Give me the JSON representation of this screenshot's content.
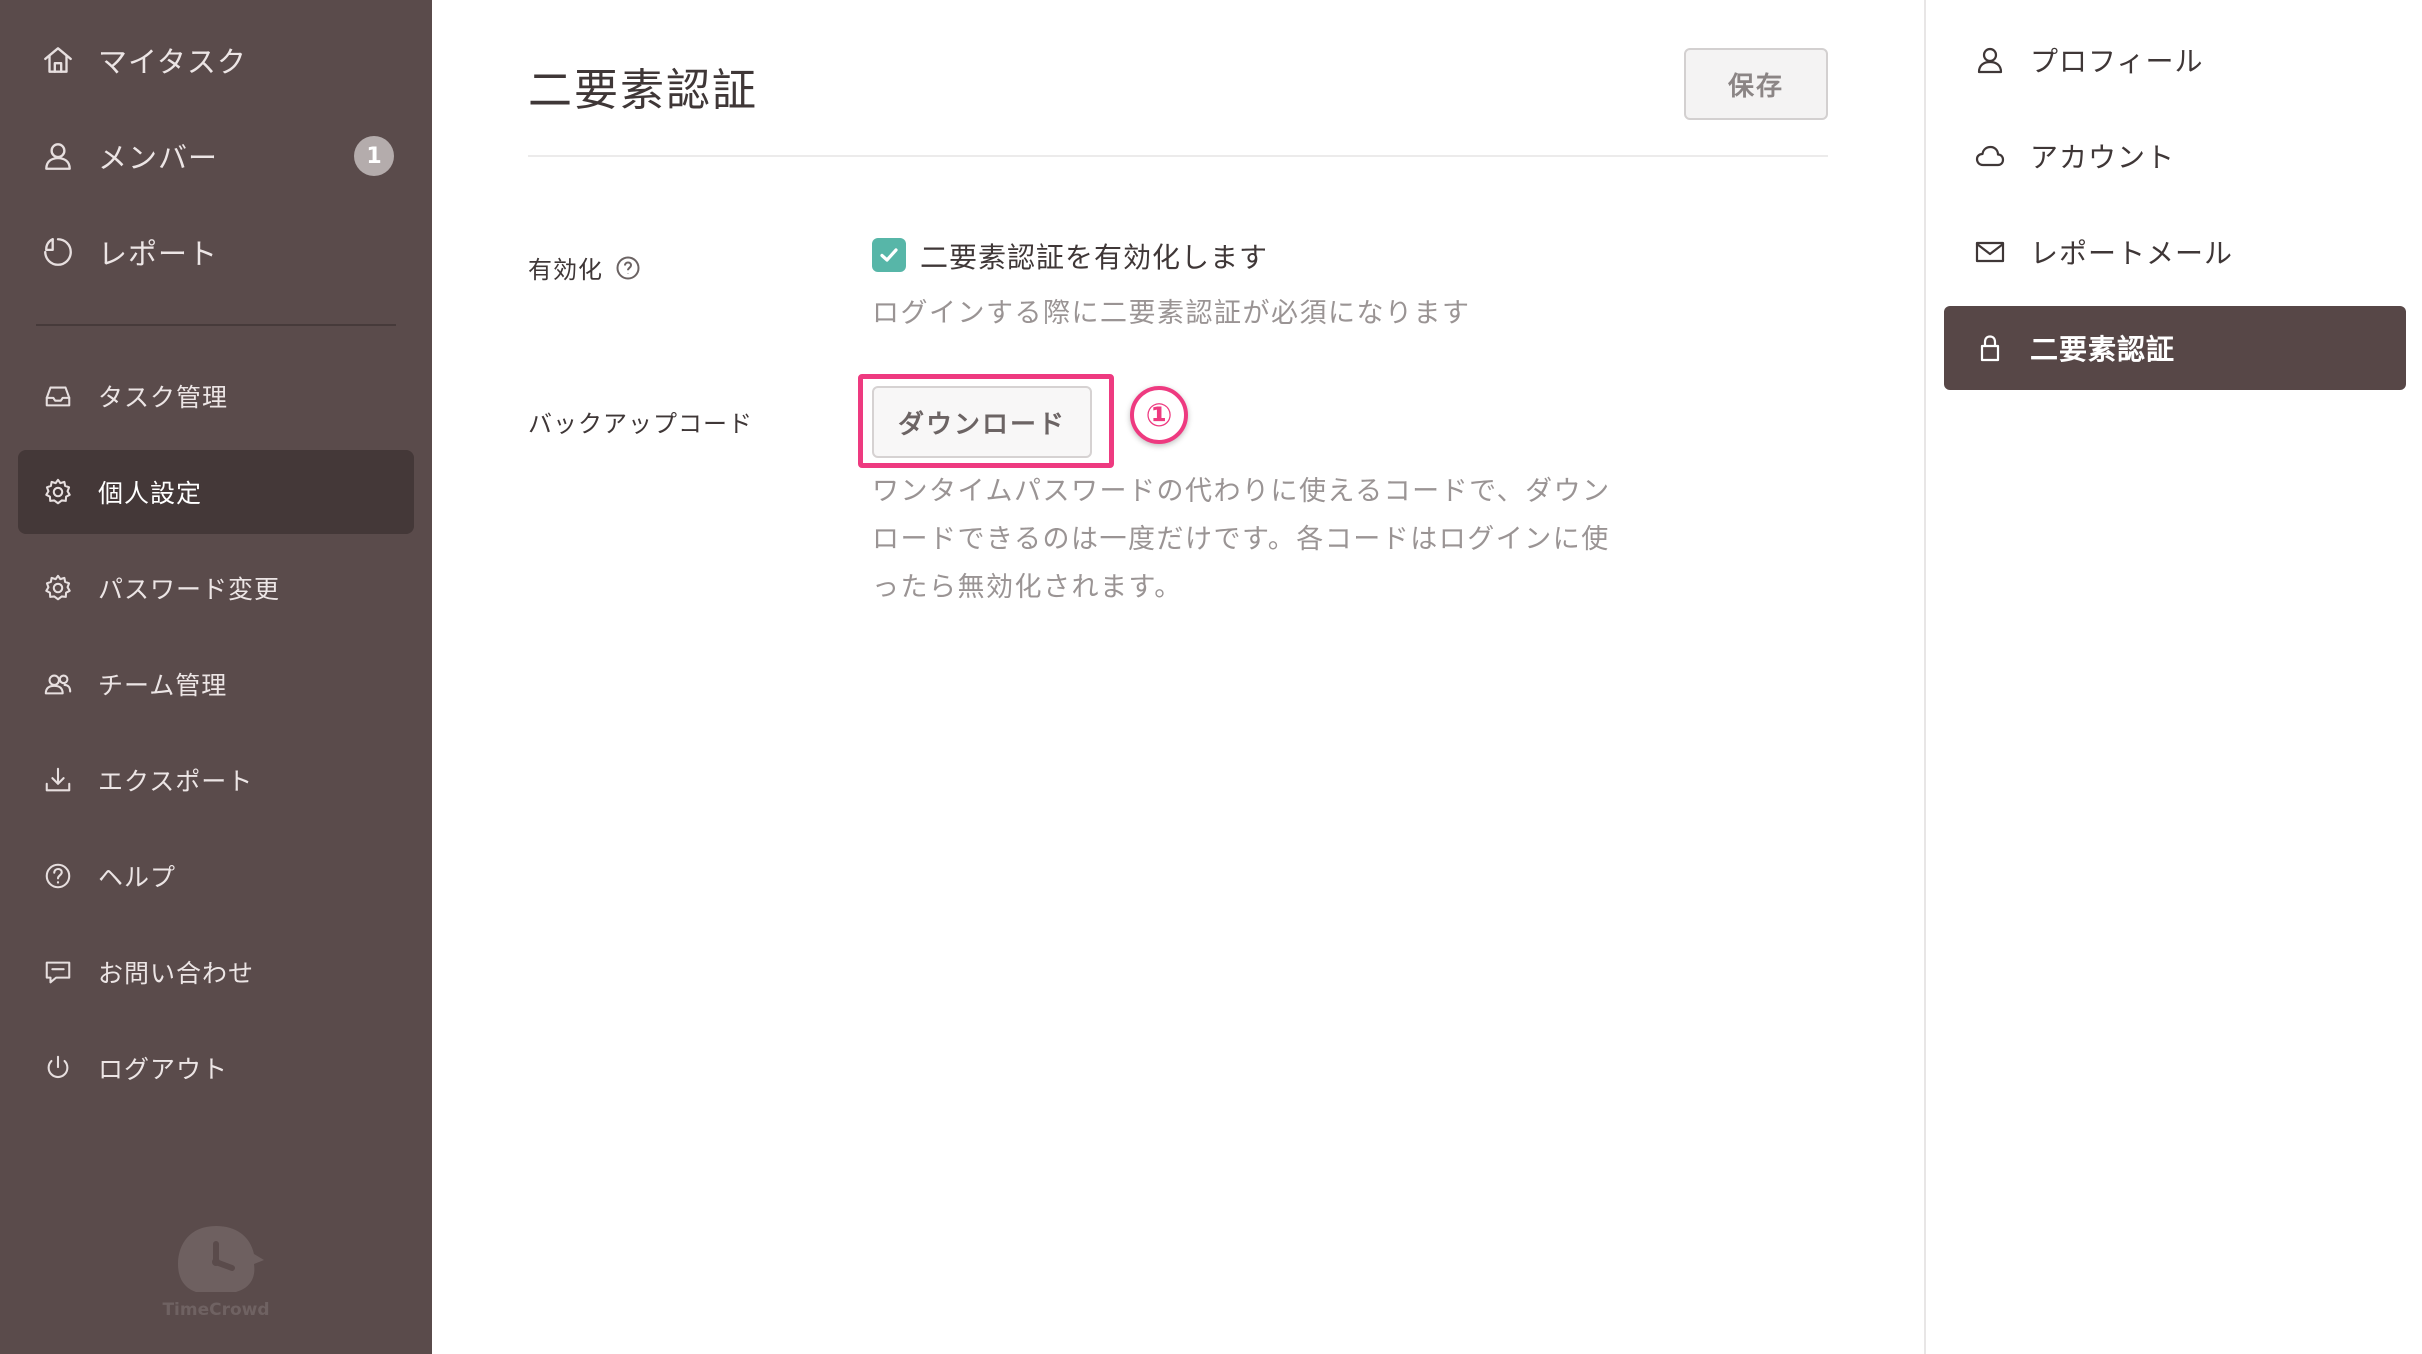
{
  "sidebar": {
    "items": [
      {
        "label": "マイタスク",
        "icon": "home-icon"
      },
      {
        "label": "メンバー",
        "icon": "user-icon",
        "badge": "1"
      },
      {
        "label": "レポート",
        "icon": "chart-icon"
      },
      {
        "label": "タスク管理",
        "icon": "inbox-icon"
      },
      {
        "label": "個人設定",
        "icon": "gear-icon",
        "active": true
      },
      {
        "label": "パスワード変更",
        "icon": "gear-icon"
      },
      {
        "label": "チーム管理",
        "icon": "team-icon"
      },
      {
        "label": "エクスポート",
        "icon": "download-icon"
      },
      {
        "label": "ヘルプ",
        "icon": "help-icon"
      },
      {
        "label": "お問い合わせ",
        "icon": "message-icon"
      },
      {
        "label": "ログアウト",
        "icon": "power-icon"
      }
    ],
    "logo_text": "TimeCrowd"
  },
  "main": {
    "title": "二要素認証",
    "save_label": "保存",
    "enable": {
      "label": "有効化",
      "checkbox_label": "二要素認証を有効化します",
      "checked": true,
      "hint": "ログインする際に二要素認証が必須になります"
    },
    "backup": {
      "label": "バックアップコード",
      "download_label": "ダウンロード",
      "hint_lines": [
        "ワンタイムパスワードの代わりに使えるコードで、ダウン",
        "ロードできるのは一度だけです。各コードはログインに使",
        "ったら無効化されます。"
      ]
    },
    "annotation": {
      "marker": "①",
      "color": "#ee3a80"
    }
  },
  "settings_menu": {
    "items": [
      {
        "label": "プロフィール",
        "icon": "user-icon"
      },
      {
        "label": "アカウント",
        "icon": "cloud-icon"
      },
      {
        "label": "レポートメール",
        "icon": "mail-icon"
      },
      {
        "label": "二要素認証",
        "icon": "lock-icon",
        "active": true
      }
    ]
  },
  "colors": {
    "sidebar_bg": "#5a4b4b",
    "sidebar_active": "#443838",
    "checkbox": "#57b6a8",
    "menu_active": "#574747"
  }
}
